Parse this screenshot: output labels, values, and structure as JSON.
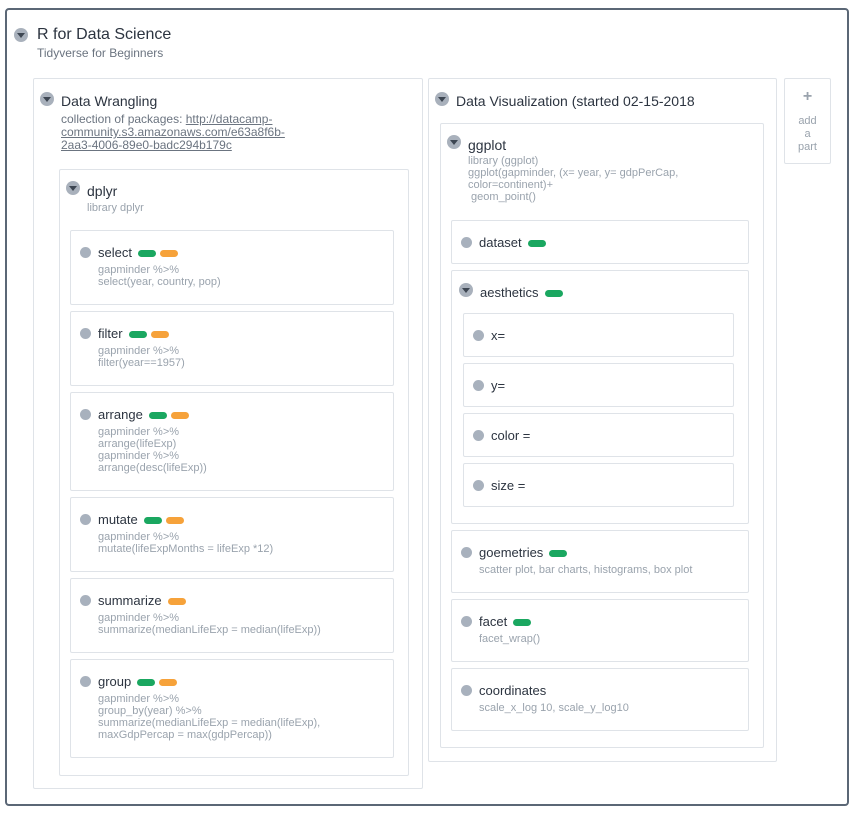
{
  "board": {
    "title": "R for Data Science",
    "subtitle": "Tidyverse for Beginners"
  },
  "wrangling": {
    "title": "Data Wrangling",
    "note_prefix": "collection of packages: ",
    "link_line1": "http://datacamp-",
    "link_line2": "community.s3.amazonaws.com/e63a8f6b-",
    "link_line3": "2aa3-4006-89e0-badc294b179c",
    "dplyr": {
      "title": "dplyr",
      "note": "library dplyr",
      "cards": [
        {
          "title": "select",
          "note": "gapminder %>%\nselect(year, country, pop)"
        },
        {
          "title": "filter",
          "note": "gapminder %>%\nfilter(year==1957)"
        },
        {
          "title": "arrange",
          "note": "gapminder %>%\narrange(lifeExp)\ngapminder %>%\narrange(desc(lifeExp))"
        },
        {
          "title": "mutate",
          "note": "gapminder %>%\nmutate(lifeExpMonths = lifeExp *12)"
        },
        {
          "title": "summarize",
          "note": "gapminder %>%\nsummarize(medianLifeExp = median(lifeExp))"
        },
        {
          "title": "group",
          "note": "gapminder %>%\ngroup_by(year) %>%\nsummarize(medianLifeExp = median(lifeExp),\nmaxGdpPercap = max(gdpPercap))"
        }
      ]
    }
  },
  "visualization": {
    "title": "Data Visualization (started 02-15-2018",
    "ggplot": {
      "title": "ggplot",
      "note": "library (ggplot)\nggplot(gapminder, (x= year, y= gdpPerCap,\ncolor=continent)+\n geom_point()",
      "cards": {
        "dataset": {
          "title": "dataset"
        },
        "aesthetics": {
          "title": "aesthetics",
          "items": [
            "x=",
            "y=",
            "color =",
            "size ="
          ]
        },
        "geometries": {
          "title": "goemetries",
          "note": "scatter plot, bar charts, histograms, box plot"
        },
        "facet": {
          "title": "facet",
          "note": "facet_wrap()"
        },
        "coordinates": {
          "title": "coordinates",
          "note": "scale_x_log 10, scale_y_log10"
        }
      }
    }
  },
  "add_part": {
    "plus": "+",
    "label": "add\na\npart"
  },
  "colors": {
    "green_tag": "#1aa760",
    "orange_tag": "#f6a23a",
    "frame": "#5b6776"
  },
  "icons": [
    "collapse-toggle-icon",
    "bullet-dot-icon",
    "plus-icon"
  ]
}
